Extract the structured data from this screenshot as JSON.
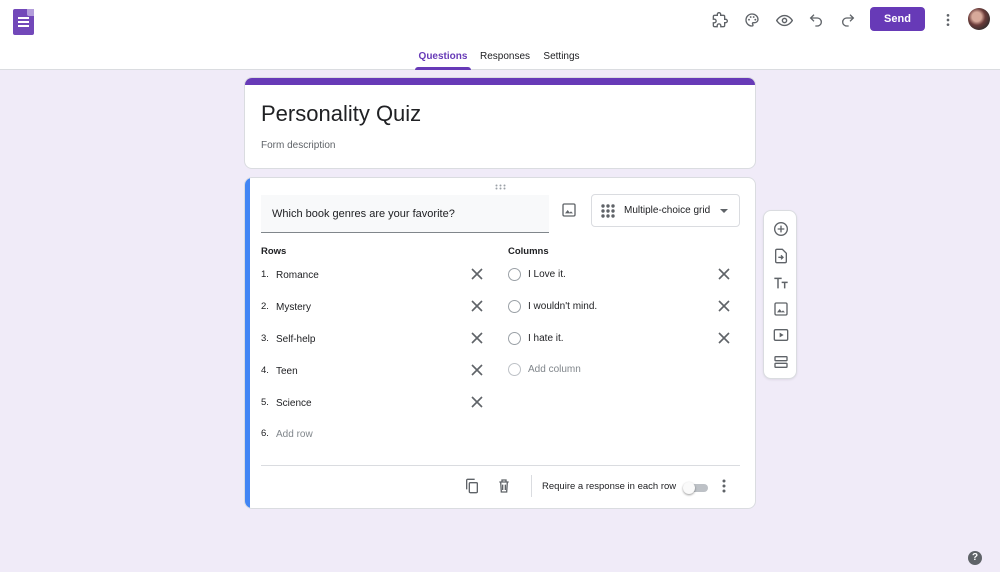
{
  "app": {
    "logo_icon": "google-forms-logo-icon",
    "brand_color": "#673ab7"
  },
  "toolbar": {
    "icons": [
      "addons-puzzle-icon",
      "palette-icon",
      "preview-eye-icon",
      "undo-icon",
      "redo-icon",
      "more-vert-icon"
    ],
    "send_label": "Send"
  },
  "tabs": [
    {
      "label": "Questions",
      "active": true
    },
    {
      "label": "Responses",
      "active": false
    },
    {
      "label": "Settings",
      "active": false
    }
  ],
  "form": {
    "title": "Personality Quiz",
    "description_placeholder": "Form description"
  },
  "question": {
    "text": "Which book genres are your favorite?",
    "type": "Multiple-choice grid",
    "rows_label": "Rows",
    "columns_label": "Columns",
    "rows": [
      {
        "num": "1.",
        "label": "Romance"
      },
      {
        "num": "2.",
        "label": "Mystery"
      },
      {
        "num": "3.",
        "label": "Self-help"
      },
      {
        "num": "4.",
        "label": "Teen"
      },
      {
        "num": "5.",
        "label": "Science"
      }
    ],
    "add_row": {
      "num": "6.",
      "label": "Add row"
    },
    "columns": [
      {
        "label": "I Love it."
      },
      {
        "label": "I wouldn't mind."
      },
      {
        "label": "I hate it."
      }
    ],
    "add_column": "Add column",
    "require_label": "Require a response in each row",
    "require_on": false
  },
  "side_toolbar": [
    "add-question-icon",
    "import-questions-icon",
    "add-title-icon",
    "add-image-icon",
    "add-video-icon",
    "add-section-icon"
  ],
  "help_label": "?"
}
